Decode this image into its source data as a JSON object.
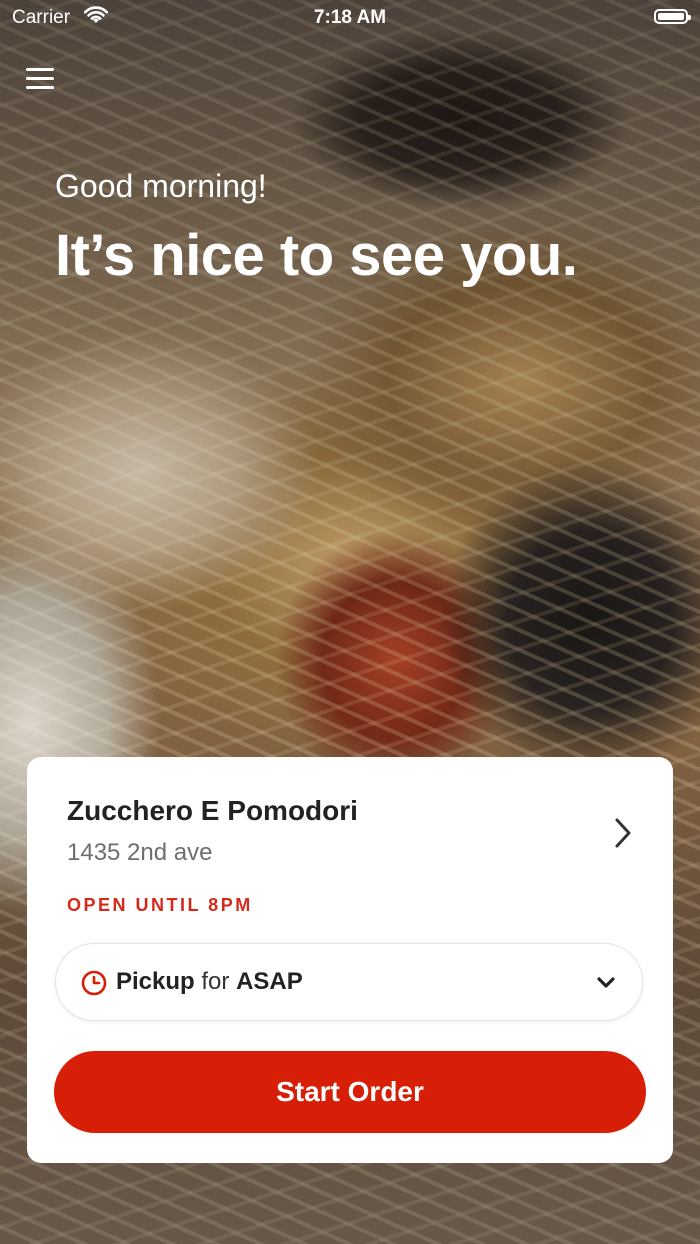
{
  "status_bar": {
    "carrier": "Carrier",
    "time": "7:18 AM",
    "battery_level": 0.95
  },
  "header": {
    "menu_icon": "hamburger-menu-icon"
  },
  "hero": {
    "greeting": "Good morning!",
    "headline": "It’s nice to see you."
  },
  "store": {
    "name": "Zucchero E Pomodori",
    "address": "1435 2nd ave",
    "hours": "OPEN UNTIL 8PM"
  },
  "order": {
    "mode": "Pickup",
    "connector": "for",
    "time": "ASAP",
    "start_label": "Start Order"
  },
  "colors": {
    "accent": "#d71f07",
    "hours_text": "#d42a1a"
  }
}
